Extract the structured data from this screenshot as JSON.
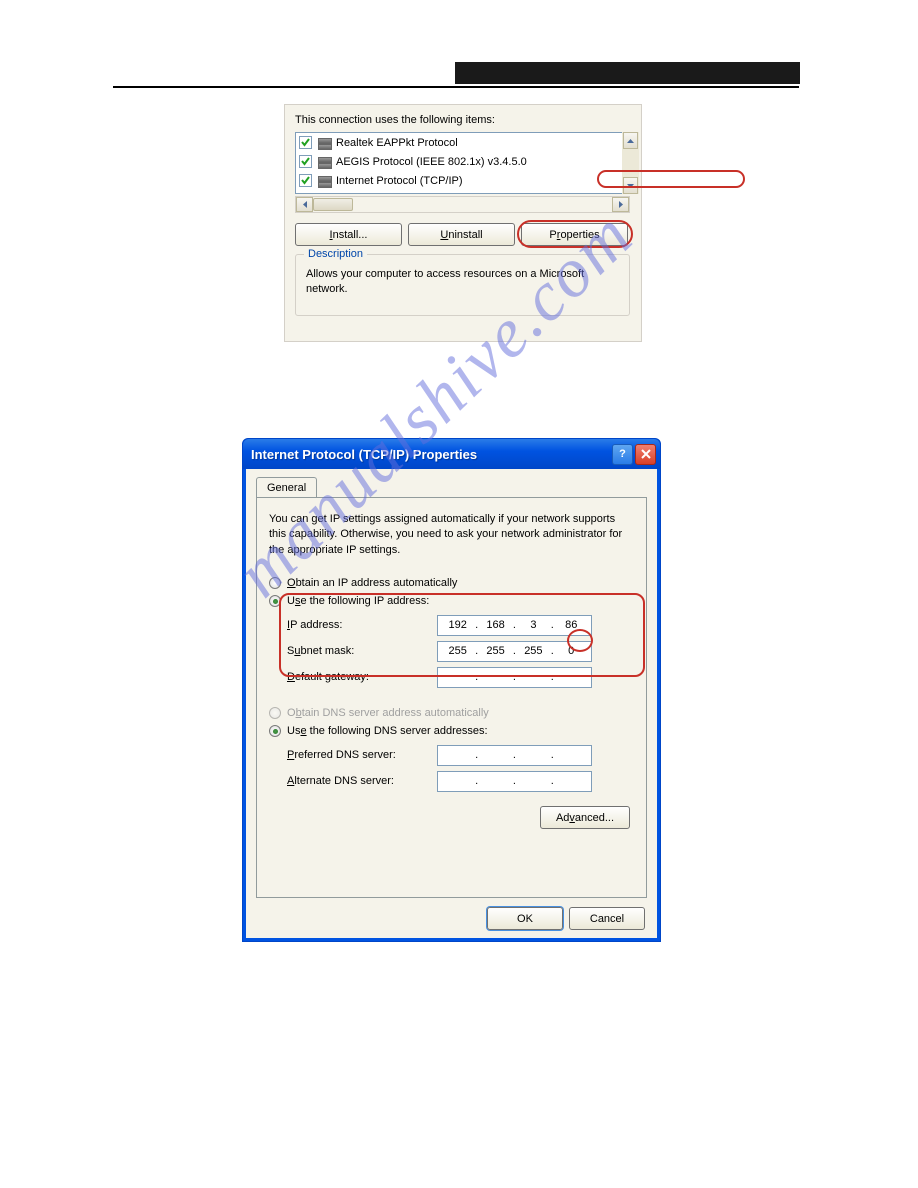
{
  "headerColor": "#1a1a1a",
  "panel1": {
    "label": "This connection uses the following items:",
    "items": [
      {
        "checked": true,
        "label": "Realtek EAPPkt Protocol"
      },
      {
        "checked": true,
        "label": "AEGIS Protocol (IEEE 802.1x) v3.4.5.0"
      },
      {
        "checked": true,
        "label": "Internet Protocol (TCP/IP)"
      }
    ],
    "buttons": {
      "install": "Install...",
      "uninstall": "Uninstall",
      "properties": "Properties"
    },
    "descTitle": "Description",
    "descText": "Allows your computer to access resources on a Microsoft network."
  },
  "panel2": {
    "title": "Internet Protocol (TCP/IP) Properties",
    "tab": "General",
    "info": "You can get IP settings assigned automatically if your network supports this capability. Otherwise, you need to ask your network administrator for the appropriate IP settings.",
    "radio_obtain_ip": "Obtain an IP address automatically",
    "radio_use_ip": "Use the following IP address:",
    "ip_label": "IP address:",
    "ip_value": [
      "192",
      "168",
      "3",
      "86"
    ],
    "subnet_label": "Subnet mask:",
    "subnet_value": [
      "255",
      "255",
      "255",
      "0"
    ],
    "gateway_label": "Default gateway:",
    "gateway_value": [
      "",
      "",
      "",
      ""
    ],
    "radio_obtain_dns": "Obtain DNS server address automatically",
    "radio_use_dns": "Use the following DNS server addresses:",
    "pref_dns_label": "Preferred DNS server:",
    "alt_dns_label": "Alternate DNS server:",
    "advanced": "Advanced...",
    "ok": "OK",
    "cancel": "Cancel"
  },
  "watermark": "manualshive.com"
}
